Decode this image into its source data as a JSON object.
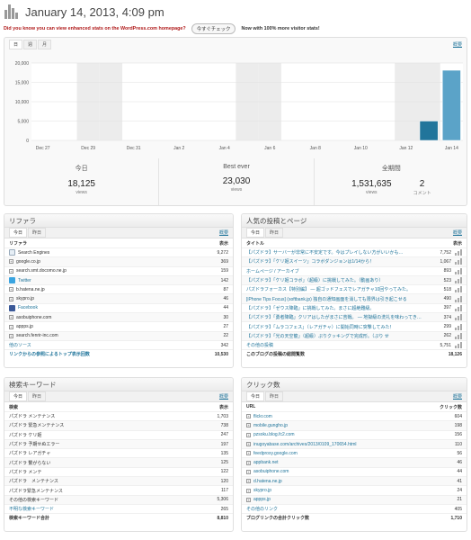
{
  "header": {
    "title": "January 14, 2013, 4:09 pm"
  },
  "notice": {
    "text": "Did you know you can view enhanced stats on the WordPress.com homepage?",
    "button": "今すぐチェック",
    "extra": "Now with 100% more visitor stats!"
  },
  "colors": {
    "bar": "#21759b",
    "bar_light": "#5ba3c8",
    "weekend": "#ececec",
    "link": "#21759b"
  },
  "chart_panel": {
    "tabs": [
      "日",
      "週",
      "月"
    ],
    "summary_link": "概要"
  },
  "chart_data": {
    "type": "bar",
    "categories": [
      "Dec 27",
      "Dec 28",
      "Dec 29",
      "Dec 30",
      "Dec 31",
      "Jan 1",
      "Jan 2",
      "Jan 3",
      "Jan 4",
      "Jan 5",
      "Jan 6",
      "Jan 7",
      "Jan 8",
      "Jan 9",
      "Jan 10",
      "Jan 11",
      "Jan 12",
      "Jan 13",
      "Jan 14"
    ],
    "tick_labels": [
      "Dec 27",
      "Dec 29",
      "Dec 31",
      "Jan 2",
      "Jan 4",
      "Jan 6",
      "Jan 8",
      "Jan 10",
      "Jan 12",
      "Jan 14"
    ],
    "values": [
      0,
      0,
      0,
      0,
      0,
      0,
      0,
      0,
      0,
      0,
      0,
      0,
      0,
      0,
      0,
      0,
      0,
      5000,
      18125
    ],
    "yticks": [
      "20,000",
      "15,000",
      "10,000",
      "5,000",
      "0"
    ],
    "ylim": [
      0,
      20000
    ],
    "grid": true
  },
  "summary": {
    "today": {
      "label": "今日",
      "value": "18,125",
      "unit": "views"
    },
    "best": {
      "label": "Best ever",
      "value": "23,030",
      "unit": "views"
    },
    "total": {
      "label": "全期間",
      "views": "1,531,635",
      "views_unit": "views",
      "comments": "2",
      "comments_unit": "コメント"
    }
  },
  "referrers": {
    "title": "リファラ",
    "tabs": [
      "今日",
      "昨日"
    ],
    "summary_link": "概要",
    "col_name": "リファラ",
    "col_val": "表示",
    "rows": [
      {
        "name": "Search Engines",
        "val": "9,272",
        "icon": "search-icon"
      },
      {
        "name": "google.co.jp",
        "val": "369"
      },
      {
        "name": "search.smt.docomo.ne.jp",
        "val": "159"
      },
      {
        "name": "Twitter",
        "val": "142",
        "icon": "twitter-icon"
      },
      {
        "name": "b.hatena.ne.jp",
        "val": "87"
      },
      {
        "name": "skypro.jp",
        "val": "46"
      },
      {
        "name": "Facebook",
        "val": "44",
        "icon": "facebook-icon"
      },
      {
        "name": "asobuiphone.com",
        "val": "30"
      },
      {
        "name": "appps.jp",
        "val": "27"
      },
      {
        "name": "search.fenrir-inc.com",
        "val": "22"
      },
      {
        "name": "他のソース",
        "val": "342"
      }
    ],
    "more": "リンクからの参照によるトップ表示回数",
    "total": "10,530"
  },
  "posts": {
    "title": "人気の投稿とページ",
    "tabs": [
      "今日",
      "昨日"
    ],
    "summary_link": "概要",
    "col_name": "タイトル",
    "col_val": "表示",
    "rows": [
      {
        "name": "【パズドラ】サーバーが非常に不安定です。今はプレイしない方がいいかも…",
        "val": "7,752"
      },
      {
        "name": "【パズドラ】「ケリ姫スイーツ」コラボダンジョンは1/14から！",
        "val": "1,067"
      },
      {
        "name": "ホームページ / アーカイブ",
        "val": "893"
      },
      {
        "name": "【パズドラ】「ケリ姫コラボ」（超級）に挑戦してみた。（動画あり）",
        "val": "523"
      },
      {
        "name": "パズドラフォーカス【特別編】 — 超ゴッドフェスでレアガチャ10回やってみた。",
        "val": "518"
      },
      {
        "name": "[iPhone Tips Focus] (softbank.jp) 独自の通知画面を消しても限界は引き起こせる",
        "val": "490"
      },
      {
        "name": "【パズドラ】「ゼウス降臨」に挑戦してみた。まさに超絶難級。",
        "val": "397"
      },
      {
        "name": "【パズドラ】「勇者降臨」クリアはしたがまさに苦戦。 — 地獄級の洗礼を味わってきました。",
        "val": "374"
      },
      {
        "name": "【パズドラ】「ムラコフェス」（レアガチャ）に開始同時に突撃してみた！",
        "val": "299"
      },
      {
        "name": "【パズドラ】「光の天空龍」（超級）ぷりクッキングで完成形。（ぷり せ",
        "val": "262"
      },
      {
        "name": "その他の投稿",
        "val": "5,751"
      }
    ],
    "total_label": "このブログの投稿の総閲覧数",
    "total": "18,126"
  },
  "keywords": {
    "title": "検索キーワード",
    "tabs": [
      "今日",
      "昨日"
    ],
    "summary_link": "概要",
    "col_name": "検索",
    "col_val": "表示",
    "rows": [
      {
        "name": "パズドラ メンテナンス",
        "val": "1,703"
      },
      {
        "name": "パズドラ 緊急メンテナンス",
        "val": "738"
      },
      {
        "name": "パズドラ ケリ姫",
        "val": "247"
      },
      {
        "name": "パズドラ 予期せぬエラー",
        "val": "197"
      },
      {
        "name": "パズドラ レアガチャ",
        "val": "135"
      },
      {
        "name": "パズドラ 繋がらない",
        "val": "125"
      },
      {
        "name": "パズドラ メンテ",
        "val": "122"
      },
      {
        "name": "パズドラ　メンテナンス",
        "val": "120"
      },
      {
        "name": "パズドラ緊急メンテナンス",
        "val": "117"
      },
      {
        "name": "その他の検索キーワード",
        "val": "5,306"
      },
      {
        "name": "不明な検索キーワード",
        "val": "265"
      }
    ],
    "total_label": "検索キーワード合計",
    "total": "8,810"
  },
  "clicks": {
    "title": "クリック数",
    "tabs": [
      "今日",
      "昨日"
    ],
    "summary_link": "概要",
    "col_name": "URL",
    "col_val": "クリック数",
    "rows": [
      {
        "name": "flickr.com",
        "val": "604"
      },
      {
        "name": "mobile.gungho.jp",
        "val": "198"
      },
      {
        "name": "pzsoku.blog.fc2.com",
        "val": "156"
      },
      {
        "name": "inugoyabase.com/archives/2013/0109_170654.html",
        "val": "110"
      },
      {
        "name": "feedproxy.google.com",
        "val": "56"
      },
      {
        "name": "appbank.net",
        "val": "46"
      },
      {
        "name": "asobuiphone.com",
        "val": "44"
      },
      {
        "name": "d.hatena.ne.jp",
        "val": "41"
      },
      {
        "name": "skypro.jp",
        "val": "24"
      },
      {
        "name": "appps.jp",
        "val": "21"
      },
      {
        "name": "その他のリンク",
        "val": "405"
      }
    ],
    "total_label": "ブログリンクの合計クリック数",
    "total": "1,710"
  }
}
